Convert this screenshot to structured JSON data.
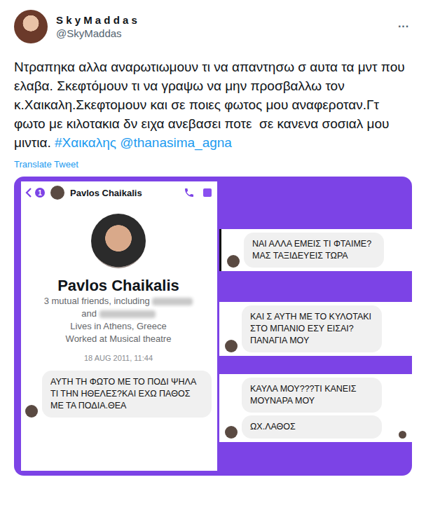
{
  "tweet": {
    "name": "S k y M a d d a s",
    "handle": "@SkyMaddas",
    "more": "···",
    "body": [
      {
        "text": "Ντραπηκα αλλα αναρωτιωμουν τι να απαντησω σ αυτα τα μντ που ελαβα. Σκεφτόμουν τι να γραψω να μην προσβαλλω τον κ.Χαικαλη.Σκεφτομουν και σε ποιες φωτος μου αναφεροταν.Γτ φωτο με κιλοτακια δν ειχα ανεβασει ποτε  σε κανενα σοσιαλ μου μιντια. ",
        "kind": "plain"
      },
      {
        "text": "#Χαικαλης",
        "kind": "link"
      },
      {
        "text": " ",
        "kind": "plain"
      },
      {
        "text": "@thanasima_agna",
        "kind": "link"
      }
    ],
    "translate": "Translate Tweet"
  },
  "messenger": {
    "badge": "1",
    "header_name": "Pavlos Chaikalis",
    "profile_name": "Pavlos Chaikalis",
    "mutual": "3 mutual friends, including",
    "mutual_and": "and",
    "lives": "Lives in Athens, Greece",
    "worked": "Worked at Musical theatre",
    "timestamp": "18 AUG 2011, 11:44",
    "messages": [
      "ΑΥΤΗ ΤΗ ΦΩΤΟ ΜΕ ΤΟ ΠΟΔΙ ΨΗΛΑ ΤΙ ΤΗΝ ΗΘΕΛΕΣ?ΚΑΙ ΕΧΩ ΠΑΘΟΣ ΜΕ ΤΑ ΠΟΔΙΑ.ΘΕΑ"
    ]
  },
  "fragments": [
    {
      "messages": [
        "ΝΑΙ ΑΛΛΑ ΕΜΕΙΣ ΤΙ ΦΤΑΙΜΕ?ΜΑΣ ΤΑΞΙΔΕΥΕΙΣ ΤΩΡΑ"
      ],
      "accent": true,
      "seen": false
    },
    {
      "messages": [
        "ΚΑΙ Σ ΑΥΤΗ ΜΕ ΤΟ ΚΥΛΟΤΑΚΙ ΣΤΟ ΜΠΑΝΙΟ ΕΣΥ ΕΙΣΑΙ?ΠΑΝΑΓΙΑ ΜΟΥ"
      ],
      "accent": false,
      "seen": false
    },
    {
      "messages": [
        "ΚΑΥΛΑ ΜΟΥ???ΤΙ ΚΑΝΕΙΣ ΜΟΥΝΑΡΑ ΜΟΥ",
        "ΩΧ.ΛΑΘΟΣ"
      ],
      "accent": false,
      "seen": true
    }
  ]
}
